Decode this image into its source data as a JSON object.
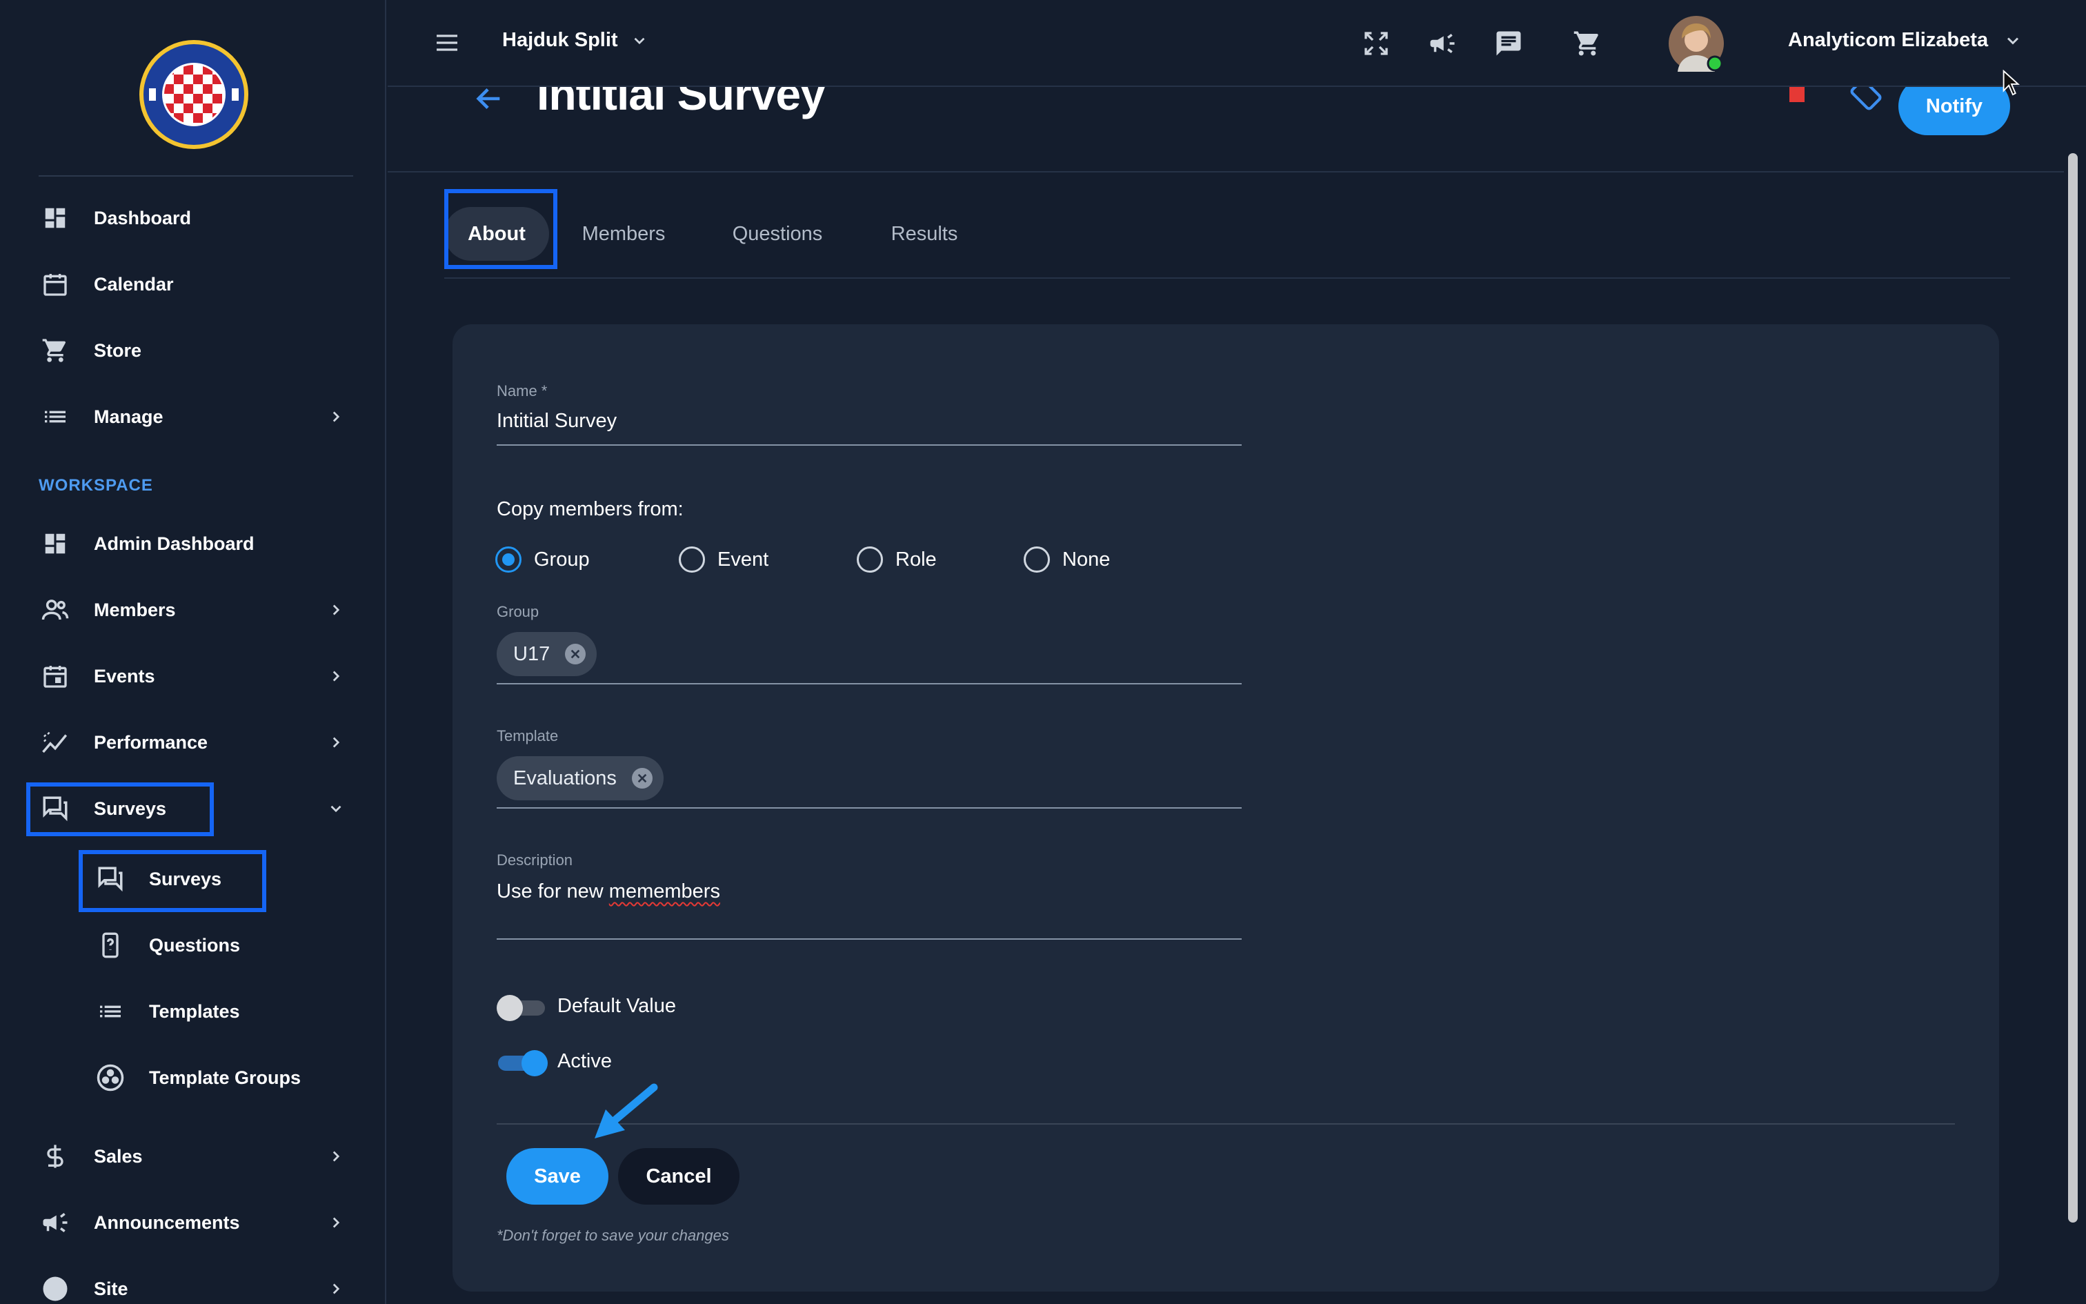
{
  "topbar": {
    "org_name": "Hajduk Split",
    "user_name": "Analyticom Elizabeta",
    "icons": [
      "menu-icon",
      "fullscreen-icon",
      "megaphone-icon",
      "chat-icon",
      "cart-icon"
    ]
  },
  "sidebar": {
    "items": [
      {
        "label": "Dashboard",
        "icon": "dashboard-icon"
      },
      {
        "label": "Calendar",
        "icon": "calendar-icon"
      },
      {
        "label": "Store",
        "icon": "cart-icon"
      },
      {
        "label": "Manage",
        "icon": "list-icon"
      }
    ],
    "section_label": "WORKSPACE",
    "workspace_items": [
      {
        "label": "Admin Dashboard",
        "icon": "dashboard-icon"
      },
      {
        "label": "Members",
        "icon": "people-icon"
      },
      {
        "label": "Events",
        "icon": "event-icon"
      },
      {
        "label": "Performance",
        "icon": "chart-icon"
      },
      {
        "label": "Surveys",
        "icon": "survey-icon"
      }
    ],
    "survey_sub_items": [
      {
        "label": "Surveys",
        "icon": "survey-icon"
      },
      {
        "label": "Questions",
        "icon": "question-icon"
      },
      {
        "label": "Templates",
        "icon": "list-icon"
      },
      {
        "label": "Template Groups",
        "icon": "groups-icon"
      }
    ],
    "bottom_items": [
      {
        "label": "Sales",
        "icon": "dollar-icon"
      },
      {
        "label": "Announcements",
        "icon": "megaphone-icon"
      },
      {
        "label": "Site",
        "icon": "globe-icon"
      }
    ]
  },
  "page": {
    "title": "Intitial Survey",
    "notify_label": "Notify"
  },
  "tabs": [
    {
      "label": "About",
      "active": true
    },
    {
      "label": "Members",
      "active": false
    },
    {
      "label": "Questions",
      "active": false
    },
    {
      "label": "Results",
      "active": false
    }
  ],
  "form": {
    "name_label": "Name *",
    "name_value": "Intitial Survey",
    "copy_label": "Copy members from:",
    "radio_options": [
      "Group",
      "Event",
      "Role",
      "None"
    ],
    "selected_option": "Group",
    "group_label": "Group",
    "group_chip": "U17",
    "template_label": "Template",
    "template_chip": "Evaluations",
    "description_label": "Description",
    "description_prefix": "Use for new ",
    "description_misspelled": "memembers",
    "default_value_label": "Default Value",
    "default_value_on": false,
    "active_label": "Active",
    "active_on": true,
    "save_label": "Save",
    "cancel_label": "Cancel",
    "hint": "*Don't forget to save your changes"
  },
  "colors": {
    "accent": "#2196f3",
    "highlight": "#1565f5",
    "background": "#141d2d",
    "card": "#1e293b"
  }
}
